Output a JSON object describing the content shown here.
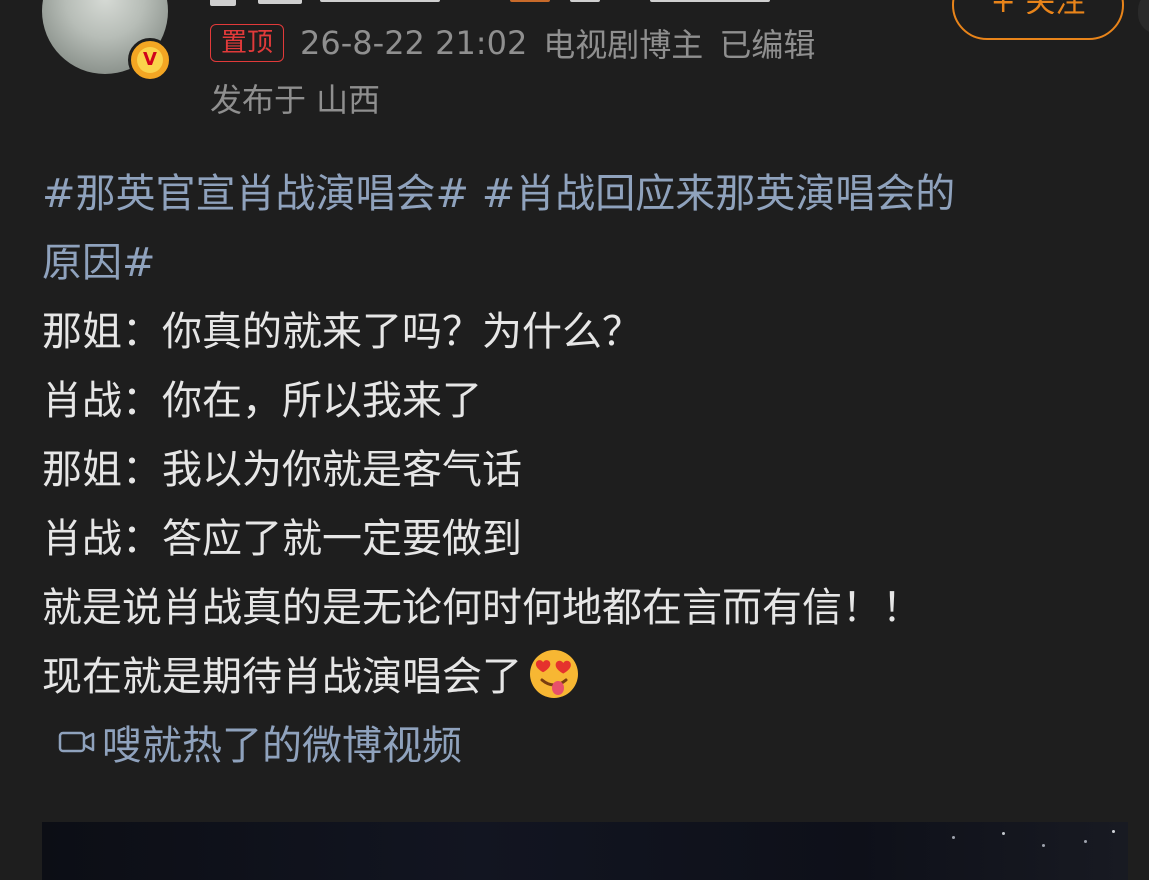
{
  "post": {
    "author_badge": "V",
    "pin_label": "置顶",
    "timestamp": "26-8-22 21:02",
    "role": "电视剧博主",
    "edited": "已编辑",
    "location": "发布于 山西",
    "follow_label": "+ 关注"
  },
  "content": {
    "hashtag_line1": "#那英官宣肖战演唱会# #肖战回应来那英演唱会的",
    "hashtag_line2": "原因#",
    "lines": [
      "那姐：你真的就来了吗？为什么？",
      "肖战：你在，所以我来了",
      "那姐：我以为你就是客气话",
      "肖战：答应了就一定要做到",
      "就是说肖战真的是无论何时何地都在言而有信！！",
      "现在就是期待肖战演唱会了"
    ],
    "last_line_emoji": "heart-eyes-tongue-emoji"
  },
  "video_link": {
    "icon": "video-camera-icon",
    "label": "嗖就热了的微博视频"
  },
  "colors": {
    "background": "#1e1e1e",
    "text": "#e6e6e6",
    "meta": "#8f8f8f",
    "link": "#8fa2bd",
    "follow": "#e8841a",
    "pin": "#e13a3a"
  }
}
